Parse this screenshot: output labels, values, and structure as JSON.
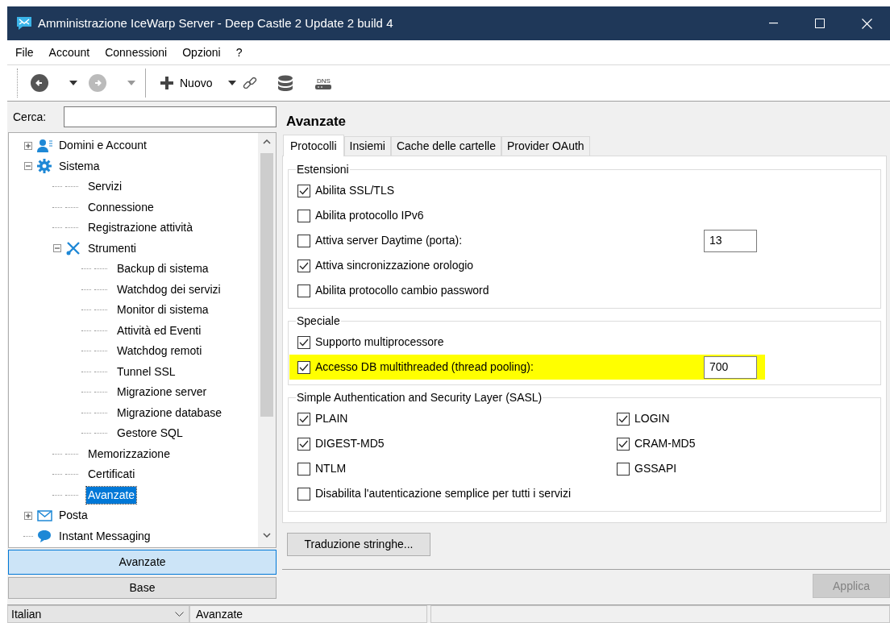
{
  "window": {
    "title": "Amministrazione IceWarp Server - Deep Castle 2 Update 2 build 4"
  },
  "menu": [
    "File",
    "Account",
    "Connessioni",
    "Opzioni",
    "?"
  ],
  "toolbar": {
    "new_button": "Nuovo",
    "dns_label": "DNS"
  },
  "search": {
    "label": "Cerca:"
  },
  "tree": [
    {
      "label": "Domini e Account",
      "kind": "users",
      "expanded": false,
      "selected": false
    },
    {
      "label": "Sistema",
      "kind": "gear",
      "expanded": true,
      "selected": false,
      "children": [
        {
          "label": "Servizi",
          "kind": "leaf",
          "selected": false
        },
        {
          "label": "Connessione",
          "kind": "leaf",
          "selected": false
        },
        {
          "label": "Registrazione attività",
          "kind": "leaf",
          "selected": false
        },
        {
          "label": "Strumenti",
          "kind": "tools",
          "expanded": true,
          "selected": false,
          "children": [
            {
              "label": "Backup di sistema",
              "kind": "leaf",
              "selected": false
            },
            {
              "label": "Watchdog dei servizi",
              "kind": "leaf",
              "selected": false
            },
            {
              "label": "Monitor di sistema",
              "kind": "leaf",
              "selected": false
            },
            {
              "label": "Attività ed Eventi",
              "kind": "leaf",
              "selected": false
            },
            {
              "label": "Watchdog remoti",
              "kind": "leaf",
              "selected": false
            },
            {
              "label": "Tunnel SSL",
              "kind": "leaf",
              "selected": false
            },
            {
              "label": "Migrazione server",
              "kind": "leaf",
              "selected": false
            },
            {
              "label": "Migrazione database",
              "kind": "leaf",
              "selected": false
            },
            {
              "label": "Gestore SQL",
              "kind": "leaf",
              "selected": false
            }
          ]
        },
        {
          "label": "Memorizzazione",
          "kind": "leaf",
          "selected": false
        },
        {
          "label": "Certificati",
          "kind": "leaf",
          "selected": false
        },
        {
          "label": "Avanzate",
          "kind": "leaf",
          "selected": true
        }
      ]
    },
    {
      "label": "Posta",
      "kind": "mail",
      "expanded": false,
      "selected": false
    },
    {
      "label": "Instant Messaging",
      "kind": "chat",
      "selected": false
    }
  ],
  "mode_buttons": [
    {
      "label": "Avanzate",
      "selected": true
    },
    {
      "label": "Base",
      "selected": false
    }
  ],
  "panel": {
    "title": "Avanzate",
    "tabs": [
      {
        "label": "Protocolli",
        "selected": true
      },
      {
        "label": "Insiemi",
        "selected": false
      },
      {
        "label": "Cache delle cartelle",
        "selected": false
      },
      {
        "label": "Provider OAuth",
        "selected": false
      }
    ],
    "groups": [
      {
        "title": "Estensioni",
        "kind": "list",
        "options": [
          {
            "label": "Abilita SSL/TLS",
            "checked": true,
            "highlighted": false
          },
          {
            "label": "Abilita protocollo IPv6",
            "checked": false,
            "highlighted": false
          },
          {
            "label": "Attiva server Daytime (porta):",
            "checked": false,
            "highlighted": false,
            "value": "13"
          },
          {
            "label": "Attiva sincronizzazione orologio",
            "checked": true,
            "highlighted": false
          },
          {
            "label": "Abilita protocollo cambio password",
            "checked": false,
            "highlighted": false
          }
        ]
      },
      {
        "title": "Speciale",
        "kind": "list",
        "options": [
          {
            "label": "Supporto multiprocessore",
            "checked": true,
            "highlighted": false
          },
          {
            "label": "Accesso DB multithreaded (thread pooling):",
            "checked": true,
            "highlighted": true,
            "value": "700"
          }
        ]
      },
      {
        "title": "Simple Authentication and Security Layer (SASL)",
        "kind": "grid",
        "options": [
          {
            "label": "PLAIN",
            "checked": true,
            "highlighted": false
          },
          {
            "label": "LOGIN",
            "checked": true,
            "highlighted": false
          },
          {
            "label": "DIGEST-MD5",
            "checked": true,
            "highlighted": false
          },
          {
            "label": "CRAM-MD5",
            "checked": true,
            "highlighted": false
          },
          {
            "label": "NTLM",
            "checked": false,
            "highlighted": false
          },
          {
            "label": "GSSAPI",
            "checked": false,
            "highlighted": false
          }
        ],
        "full_width_options": [
          {
            "label": "Disabilita l'autenticazione semplice per tutti i servizi",
            "checked": false,
            "highlighted": false
          }
        ]
      }
    ],
    "translate_button": "Traduzione stringhe...",
    "apply_button": {
      "label": "Applica",
      "disabled": true
    }
  },
  "status_bar": {
    "language": "Italian",
    "section": "Avanzate"
  }
}
